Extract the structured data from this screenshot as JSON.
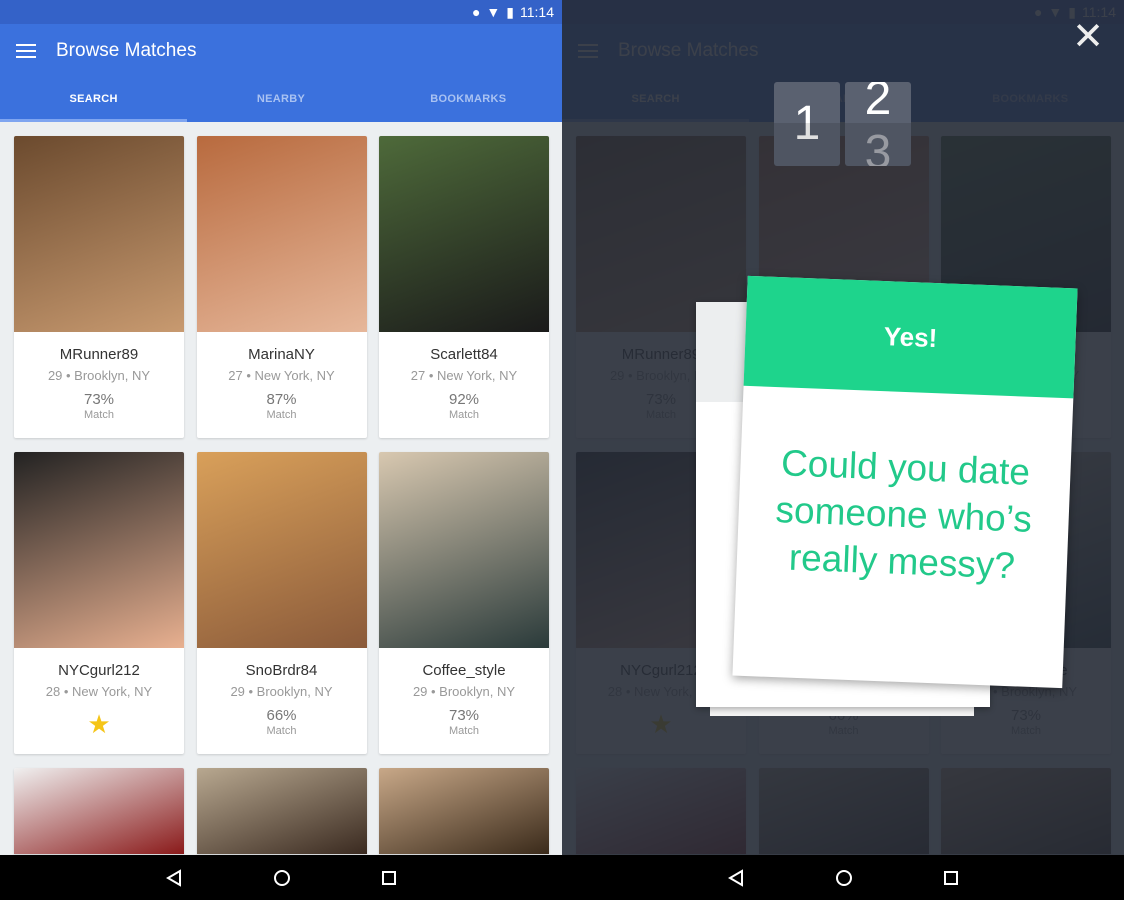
{
  "status": {
    "time": "11:14"
  },
  "toolbar": {
    "title": "Browse Matches"
  },
  "tabs": [
    "SEARCH",
    "NEARBY",
    "BOOKMARKS"
  ],
  "cards": [
    {
      "name": "MRunner89",
      "location": "29 • Brooklyn, NY",
      "match": "73%",
      "match_label": "Match",
      "colors": [
        "#6b4a2e",
        "#c89a70"
      ]
    },
    {
      "name": "MarinaNY",
      "location": "27 • New York, NY",
      "match": "87%",
      "match_label": "Match",
      "colors": [
        "#b86a3e",
        "#e6b79a"
      ]
    },
    {
      "name": "Scarlett84",
      "location": "27 • New York, NY",
      "match": "92%",
      "match_label": "Match",
      "colors": [
        "#4e6a3a",
        "#1a1a1a"
      ]
    },
    {
      "name": "NYCgurl212",
      "location": "28 • New York, NY",
      "match": null,
      "match_label": null,
      "bookmarked": true,
      "colors": [
        "#222",
        "#e8b090"
      ]
    },
    {
      "name": "SnoBrdr84",
      "location": "29 • Brooklyn, NY",
      "match": "66%",
      "match_label": "Match",
      "colors": [
        "#d9a05a",
        "#8a5a3a"
      ]
    },
    {
      "name": "Coffee_style",
      "location": "29 • Brooklyn, NY",
      "match": "73%",
      "match_label": "Match",
      "colors": [
        "#d8c8b0",
        "#2a3a3a"
      ]
    },
    {
      "colors": [
        "#f0f0f0",
        "#8a1a1a"
      ]
    },
    {
      "colors": [
        "#b8a890",
        "#3a2a20"
      ]
    },
    {
      "colors": [
        "#c8a888",
        "#3a2a1a"
      ]
    }
  ],
  "overlay": {
    "counter_current": "1",
    "counter_next": "2",
    "counter_after": "3",
    "answer_label": "Yes!",
    "question": "Could you date someone who’s really messy?",
    "accent": "#1ed48c"
  }
}
